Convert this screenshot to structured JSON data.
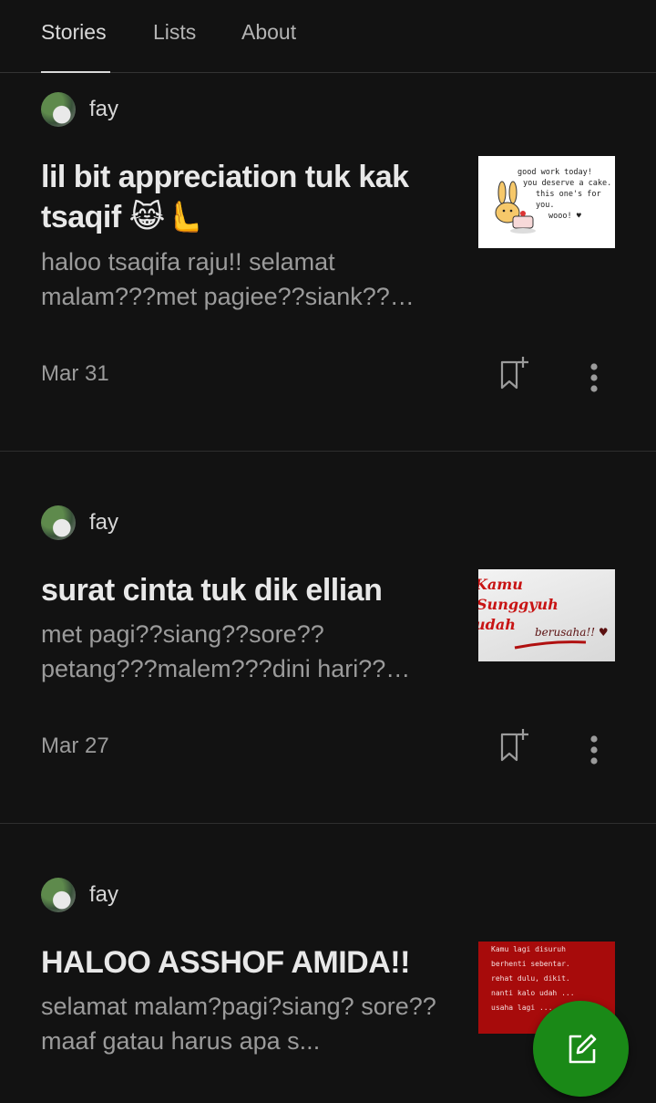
{
  "tabs": [
    {
      "label": "Stories",
      "active": true
    },
    {
      "label": "Lists",
      "active": false
    },
    {
      "label": "About",
      "active": false
    }
  ],
  "stories": [
    {
      "author": "fay",
      "title": "lil bit appreciation tuk kak tsaqif 😹🫷",
      "excerpt": "haloo tsaqifa raju!! selamat malam???met pagiee??siank??sore??petang??",
      "date": "Mar 31",
      "thumb_lines": [
        "good work today!",
        "you deserve a cake.",
        "this one's for you.",
        "wooo! ♥"
      ]
    },
    {
      "author": "fay",
      "title": "surat cinta tuk dik ellian",
      "excerpt": "met pagi??siang??sore?? petang???malem???dini hari??subuh??",
      "date": "Mar 27",
      "thumb_lines": [
        "Kamu",
        "Sunggyuh",
        "udah"
      ],
      "thumb_sig": "berusaha!! ♥"
    },
    {
      "author": "fay",
      "title": "HALOO ASSHOF AMIDA!!",
      "excerpt": "selamat malam?pagi?siang? sore?? maaf gatau harus apa s...",
      "date": "",
      "thumb_lines": [
        "Kamu lagi disuruh",
        "berhenti sebentar.",
        "        rehat dulu, dikit.",
        "nanti kalo udah ...",
        "usaha lagi ..."
      ]
    }
  ],
  "colors": {
    "background": "#121212",
    "fab": "#1a8917",
    "thumb3": "#a70b0b"
  },
  "icons": {
    "save": "bookmark-plus-icon",
    "more": "vertical-ellipsis-icon",
    "write": "compose-icon"
  }
}
